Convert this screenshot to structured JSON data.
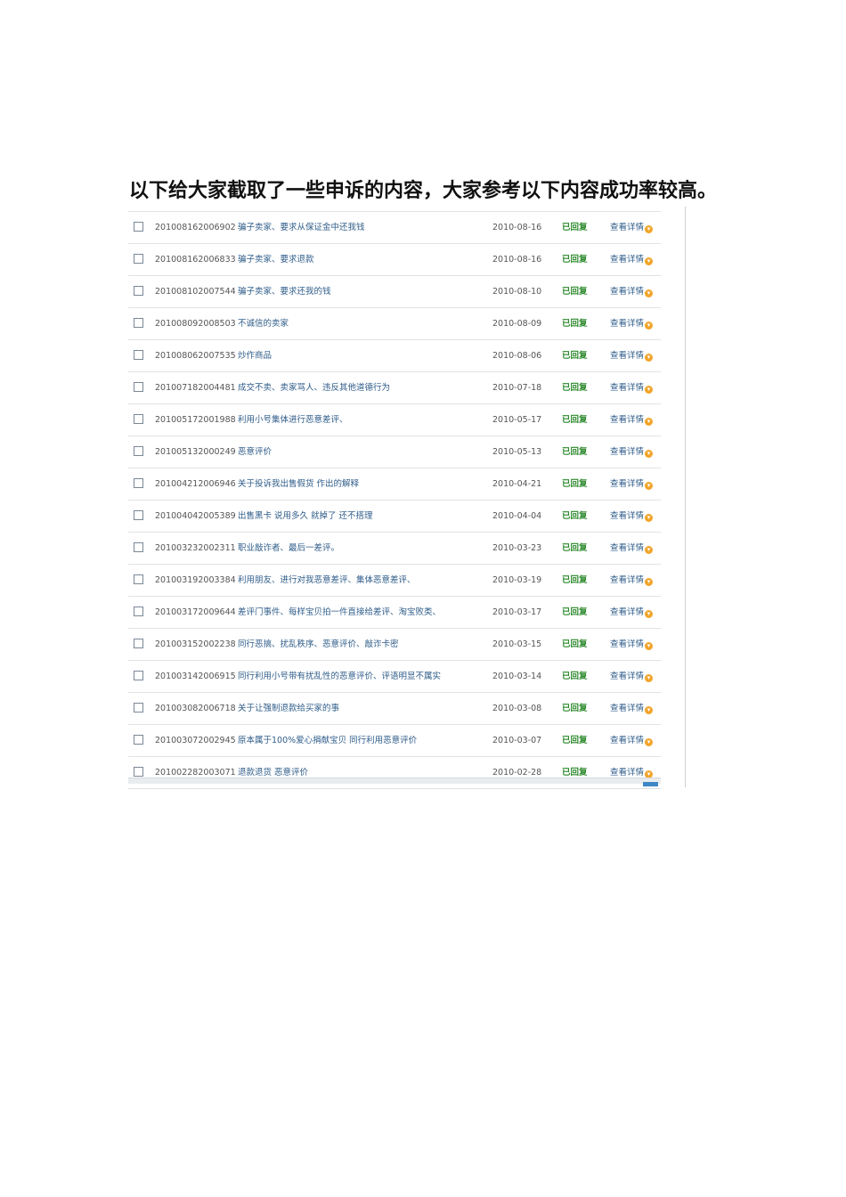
{
  "heading": "以下给大家截取了一些申诉的内容，大家参考以下内容成功率较高。",
  "rows": [
    {
      "id": "201008162006902",
      "title": "骗子卖家、要求从保证金中还我钱",
      "date": "2010-08-16",
      "status": "已回复",
      "detail": "查看详情"
    },
    {
      "id": "201008162006833",
      "title": "骗子卖家、要求退款",
      "date": "2010-08-16",
      "status": "已回复",
      "detail": "查看详情"
    },
    {
      "id": "201008102007544",
      "title": "骗子卖家、要求还我的钱",
      "date": "2010-08-10",
      "status": "已回复",
      "detail": "查看详情"
    },
    {
      "id": "201008092008503",
      "title": "不诚信的卖家",
      "date": "2010-08-09",
      "status": "已回复",
      "detail": "查看详情"
    },
    {
      "id": "201008062007535",
      "title": "炒作商品",
      "date": "2010-08-06",
      "status": "已回复",
      "detail": "查看详情"
    },
    {
      "id": "201007182004481",
      "title": "成交不卖、卖家骂人、违反其他道德行为",
      "date": "2010-07-18",
      "status": "已回复",
      "detail": "查看详情"
    },
    {
      "id": "201005172001988",
      "title": "利用小号集体进行恶意差评、",
      "date": "2010-05-17",
      "status": "已回复",
      "detail": "查看详情"
    },
    {
      "id": "201005132000249",
      "title": "恶意评价",
      "date": "2010-05-13",
      "status": "已回复",
      "detail": "查看详情"
    },
    {
      "id": "201004212006946",
      "title": "关于投诉我出售假货 作出的解释",
      "date": "2010-04-21",
      "status": "已回复",
      "detail": "查看详情"
    },
    {
      "id": "201004042005389",
      "title": "出售黑卡 说用多久 就掉了 还不搭理",
      "date": "2010-04-04",
      "status": "已回复",
      "detail": "查看详情"
    },
    {
      "id": "201003232002311",
      "title": "职业敲诈者、最后一差评。",
      "date": "2010-03-23",
      "status": "已回复",
      "detail": "查看详情"
    },
    {
      "id": "201003192003384",
      "title": "利用朋友、进行对我恶意差评、集体恶意差评、",
      "date": "2010-03-19",
      "status": "已回复",
      "detail": "查看详情"
    },
    {
      "id": "201003172009644",
      "title": "差评门事件、每样宝贝拍一件直接给差评、淘宝败类、",
      "date": "2010-03-17",
      "status": "已回复",
      "detail": "查看详情"
    },
    {
      "id": "201003152002238",
      "title": "同行恶搞、扰乱秩序、恶意评价、敲诈卡密",
      "date": "2010-03-15",
      "status": "已回复",
      "detail": "查看详情"
    },
    {
      "id": "201003142006915",
      "title": "同行利用小号带有扰乱性的恶意评价、评语明显不属实",
      "date": "2010-03-14",
      "status": "已回复",
      "detail": "查看详情"
    },
    {
      "id": "201003082006718",
      "title": "关于让强制退款给买家的事",
      "date": "2010-03-08",
      "status": "已回复",
      "detail": "查看详情"
    },
    {
      "id": "201003072002945",
      "title": "原本属于100%爱心捐献宝贝 同行利用恶意评价",
      "date": "2010-03-07",
      "status": "已回复",
      "detail": "查看详情"
    },
    {
      "id": "201002282003071",
      "title": "退款退货 恶意评价",
      "date": "2010-02-28",
      "status": "已回复",
      "detail": "查看详情"
    }
  ],
  "icons": {
    "checkbox": "checkbox-icon",
    "detail": "chevron-down-circle-icon"
  },
  "colors": {
    "link": "#2f5d8a",
    "status": "#2e8a2e",
    "badge": "#f2a52b",
    "accent": "#3f87c6"
  }
}
